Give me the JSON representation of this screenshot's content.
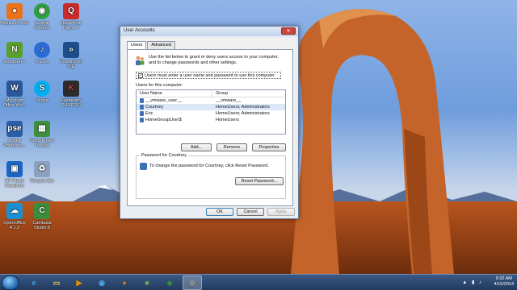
{
  "desktop": {
    "icons": [
      {
        "label": "Mozilla Firefox",
        "icon": "firefox-icon",
        "color": "#e8731b"
      },
      {
        "label": "Google Chrome",
        "icon": "chrome-icon",
        "color": "#2f9e44"
      },
      {
        "label": "QuickTime Player 7",
        "icon": "quicktime-icon",
        "color": "#c92a2a"
      },
      {
        "label": "Notepad++",
        "icon": "notepad-plus-icon",
        "color": "#5aa02c"
      },
      {
        "label": "iTunes",
        "icon": "itunes-icon",
        "color": "#2b6cd4"
      },
      {
        "label": "PowerShell ISE",
        "icon": "powershell-icon",
        "color": "#1d4e89"
      },
      {
        "label": "Microsoft Office Wo...",
        "icon": "word-icon",
        "color": "#2b579a"
      },
      {
        "label": "Skype",
        "icon": "skype-icon",
        "color": "#00aff0"
      },
      {
        "label": "Kaspersky PURE 3.0",
        "icon": "kaspersky-icon",
        "color": "#2b2b2b"
      },
      {
        "label": "Adobe Photosho...",
        "icon": "photoshop-icon",
        "color": "#2c5ea8"
      },
      {
        "label": "Color Picker Tracker",
        "icon": "color-picker-icon",
        "color": "#3f8f3f"
      },
      {
        "label": "HP Photo Creations",
        "icon": "hp-photo-icon",
        "color": "#1a66c5"
      },
      {
        "label": "Recycle Bin",
        "icon": "recycle-bin-icon",
        "color": "#8aa1bf"
      },
      {
        "label": "OpenOffice 4.1.2",
        "icon": "openoffice-icon",
        "color": "#1c8fd1"
      },
      {
        "label": "Camtasia Studio 8",
        "icon": "camtasia-icon",
        "color": "#3b8c3b"
      }
    ]
  },
  "dialog": {
    "title": "User Accounts",
    "close_label": "✕",
    "tabs": [
      {
        "label": "Users"
      },
      {
        "label": "Advanced"
      }
    ],
    "intro_text": "Use the list below to grant or deny users access to your computer, and to change passwords and other settings.",
    "require_password_label": "Users must enter a user name and password to use this computer.",
    "require_password_checked": "✓",
    "users_for_label": "Users for this computer:",
    "columns": [
      "User Name",
      "Group"
    ],
    "rows": [
      {
        "name": "__vmware_user__",
        "group": "__vmware__"
      },
      {
        "name": "Courtney",
        "group": "HomeUsers; Administrators"
      },
      {
        "name": "Eric",
        "group": "HomeUsers; Administrators"
      },
      {
        "name": "HomeGroupUser$",
        "group": "HomeUsers"
      }
    ],
    "selected_row": "Courtney",
    "buttons": {
      "add": "Add...",
      "remove": "Remove",
      "properties": "Properties"
    },
    "password_group_title": "Password for Courtney",
    "password_group_text": "To change the password for Courtney, click Reset Password.",
    "reset_password": "Reset Password...",
    "ok": "OK",
    "cancel": "Cancel",
    "apply": "Apply"
  },
  "taskbar": {
    "items": [
      {
        "icon": "internet-explorer-icon",
        "glyph": "e",
        "color": "#3d9be9"
      },
      {
        "icon": "file-explorer-icon",
        "glyph": "▭",
        "color": "#f2c94c"
      },
      {
        "icon": "media-player-icon",
        "glyph": "▶",
        "color": "#f08c00"
      },
      {
        "icon": "windows-media-center-icon",
        "glyph": "◉",
        "color": "#4aa3df"
      },
      {
        "icon": "firefox-icon",
        "glyph": "●",
        "color": "#e8731b"
      },
      {
        "icon": "control-panel-icon",
        "glyph": "■",
        "color": "#6aa84f"
      },
      {
        "icon": "camtasia-icon",
        "glyph": "◆",
        "color": "#3b8c3b"
      },
      {
        "icon": "user-accounts-icon",
        "glyph": "☺",
        "color": "#f2d16b"
      }
    ],
    "time": "9:32 AM",
    "date": "4/15/2014"
  }
}
